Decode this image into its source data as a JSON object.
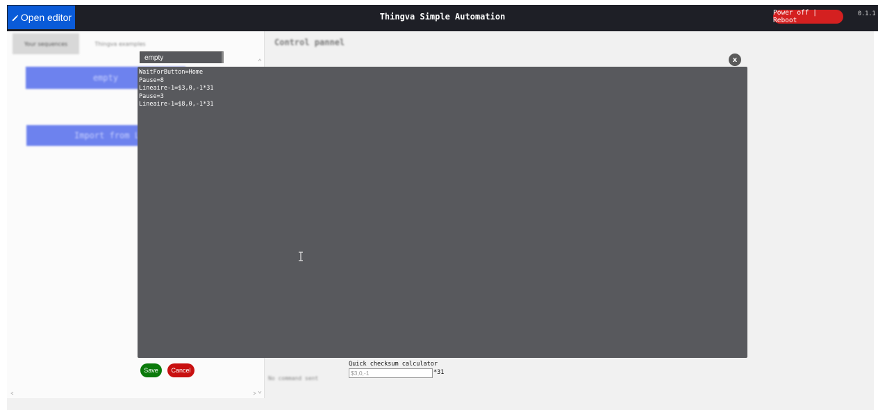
{
  "header": {
    "open_editor_label": "Open editor",
    "title": "Thingva Simple Automation",
    "power_label": "Power off | Reboot",
    "version": "0.1.1"
  },
  "sidebar": {
    "tabs": [
      "Your sequences",
      "Thingva examples"
    ],
    "sequence_button": "empty",
    "import_button": "Import from L"
  },
  "control_panel": {
    "title": "Control pannel",
    "status": "No command sent"
  },
  "editor": {
    "sequence_name": "empty",
    "content": "WaitForButton=Home\nPause=8\nLineaire-1=$3,0,-1*31\nPause=3\nLineaire-1=$8,0,-1*31",
    "close_label": "x",
    "save_label": "Save",
    "cancel_label": "Cancel"
  },
  "checksum": {
    "label": "Quick checksum calculator",
    "placeholder": "$3,0,-1",
    "result": "*31"
  },
  "colors": {
    "header_bg": "#1e1f26",
    "open_editor_bg": "#0a5bd8",
    "power_bg": "#d42020",
    "editor_bg": "#58595d",
    "save_bg": "#0b7a0b",
    "cancel_bg": "#c81010",
    "sequence_button_bg": "#6d82ee"
  }
}
